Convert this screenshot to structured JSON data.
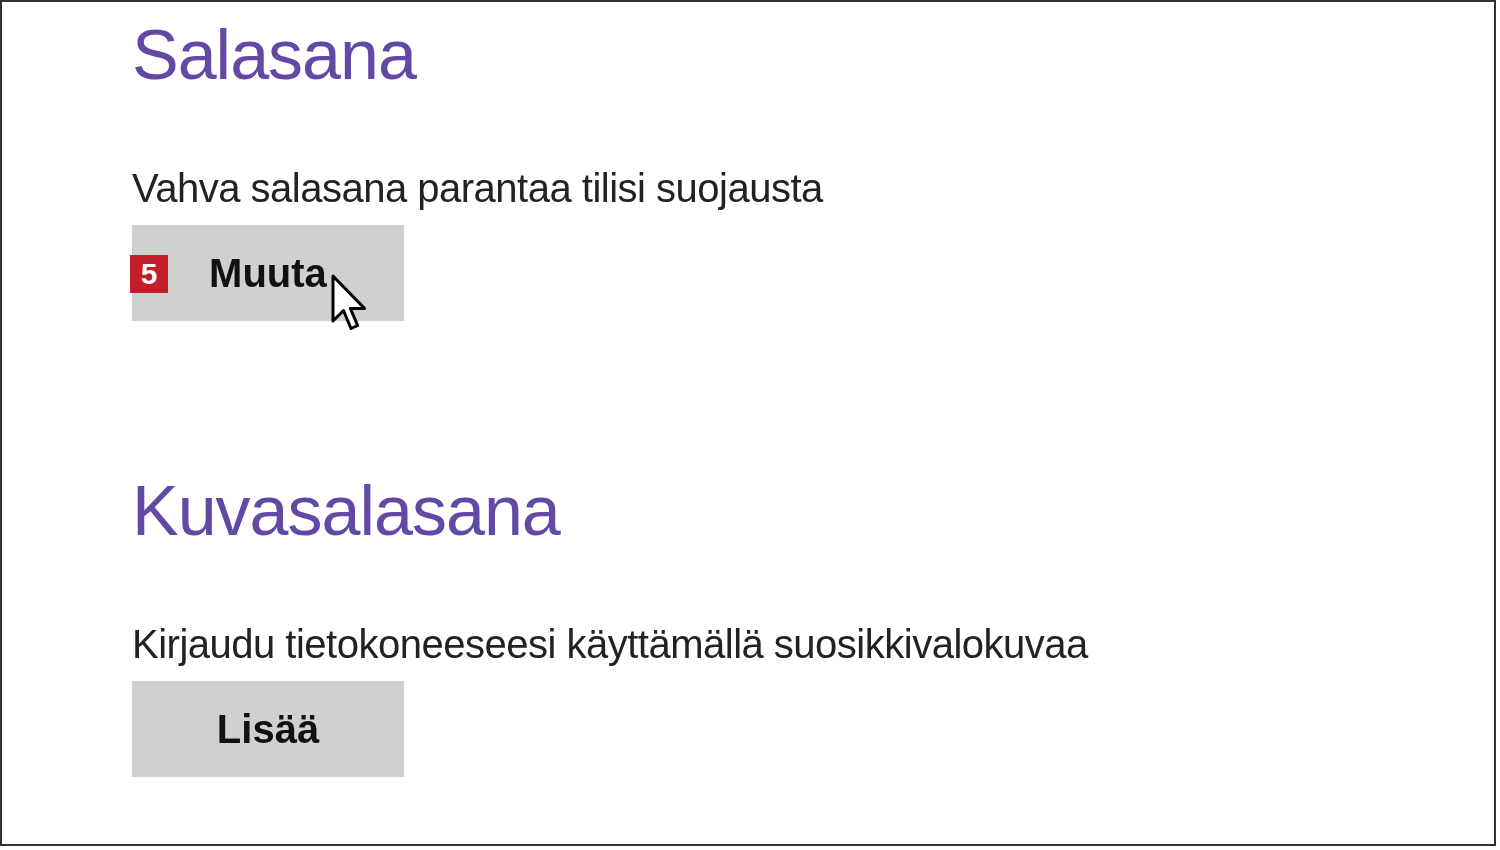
{
  "sections": [
    {
      "heading": "Salasana",
      "description": "Vahva salasana parantaa tilisi suojausta",
      "button": "Muuta",
      "step_badge": "5",
      "pointer": true
    },
    {
      "heading": "Kuvasalasana",
      "description": "Kirjaudu tietokoneeseesi käyttämällä suosikkivalokuvaa",
      "button": "Lisää",
      "pointer": false
    }
  ]
}
